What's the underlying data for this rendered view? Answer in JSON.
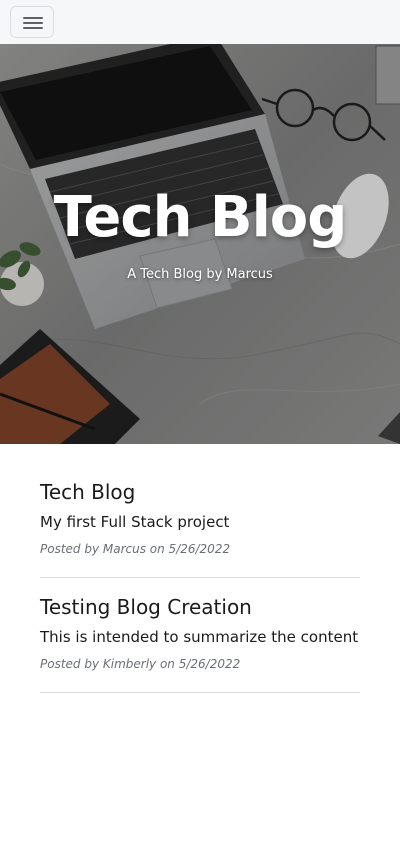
{
  "nav": {
    "menu_icon": "hamburger-menu-icon"
  },
  "hero": {
    "title": "Tech Blog",
    "subtitle": "A Tech Blog by Marcus"
  },
  "posts": [
    {
      "title": "Tech Blog",
      "summary": "My first Full Stack project",
      "meta": "Posted by Marcus on 5/26/2022"
    },
    {
      "title": "Testing Blog Creation",
      "summary": "This is intended to summarize the content",
      "meta": "Posted by Kimberly on 5/26/2022"
    }
  ],
  "colors": {
    "nav_bg": "#f6f7f9",
    "text": "#1b1b1b",
    "meta_text": "#6a6f75",
    "divider": "#dcdcdc"
  }
}
